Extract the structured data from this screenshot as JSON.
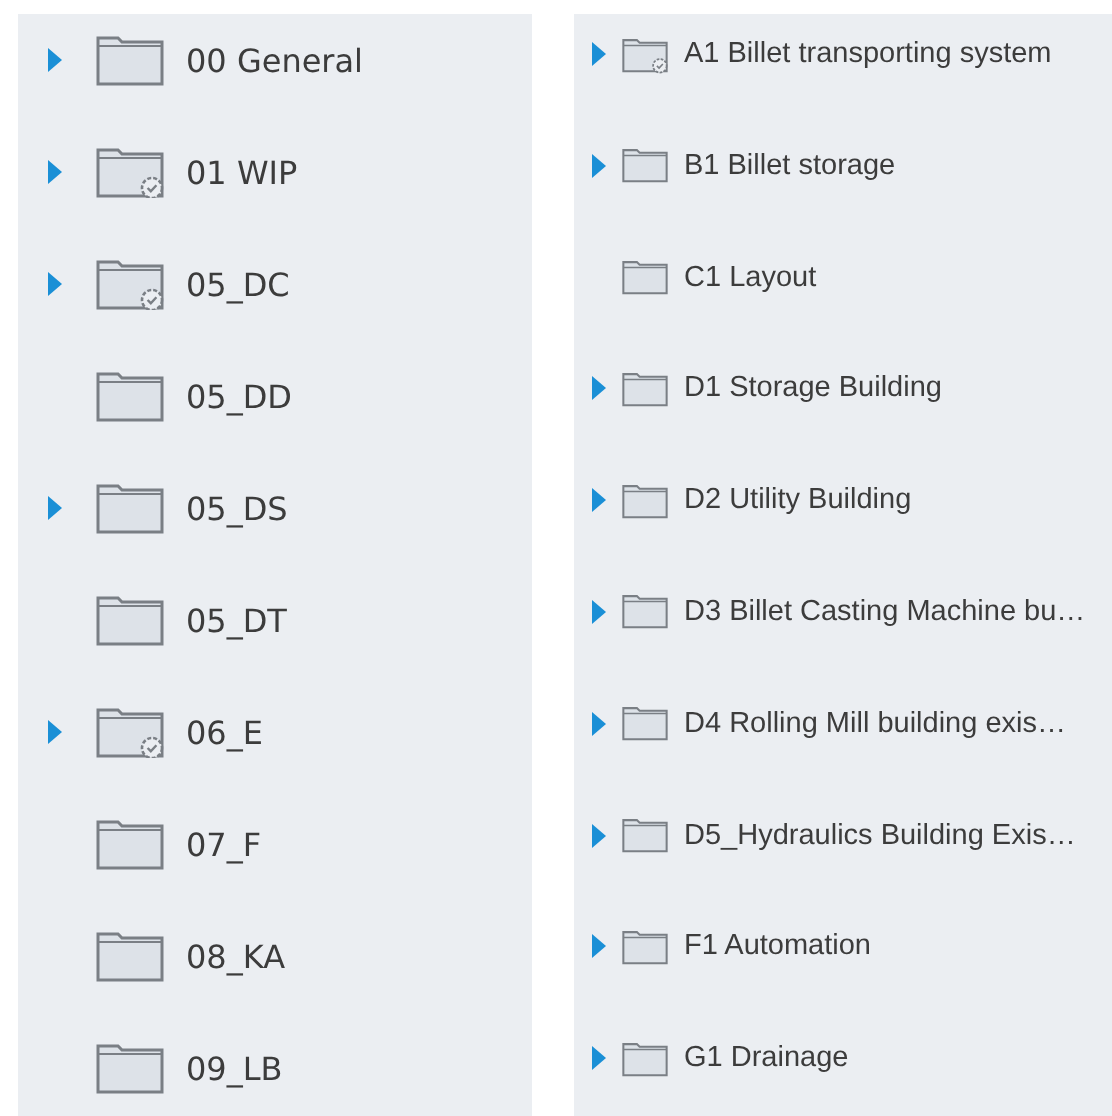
{
  "left_panel": {
    "items": [
      {
        "name": "00 General",
        "expandable": true,
        "shared": false
      },
      {
        "name": "01 WIP",
        "expandable": true,
        "shared": true
      },
      {
        "name": "05_DC",
        "expandable": true,
        "shared": true
      },
      {
        "name": "05_DD",
        "expandable": false,
        "shared": false
      },
      {
        "name": "05_DS",
        "expandable": true,
        "shared": false
      },
      {
        "name": "05_DT",
        "expandable": false,
        "shared": false
      },
      {
        "name": "06_E",
        "expandable": true,
        "shared": true
      },
      {
        "name": "07_F",
        "expandable": false,
        "shared": false
      },
      {
        "name": "08_KA",
        "expandable": false,
        "shared": false
      },
      {
        "name": "09_LB",
        "expandable": false,
        "shared": false
      }
    ]
  },
  "right_panel": {
    "items": [
      {
        "name": "A1 Billet transporting system",
        "expandable": true,
        "shared": true
      },
      {
        "name": "B1 Billet storage",
        "expandable": true,
        "shared": false
      },
      {
        "name": "C1 Layout",
        "expandable": false,
        "shared": false
      },
      {
        "name": "D1 Storage Building",
        "expandable": true,
        "shared": false
      },
      {
        "name": "D2 Utility Building",
        "expandable": true,
        "shared": false
      },
      {
        "name": "D3 Billet Casting Machine bu…",
        "expandable": true,
        "shared": false
      },
      {
        "name": "D4 Rolling Mill building exis…",
        "expandable": true,
        "shared": false
      },
      {
        "name": "D5_Hydraulics Building Exis…",
        "expandable": true,
        "shared": false
      },
      {
        "name": "F1 Automation",
        "expandable": true,
        "shared": false
      },
      {
        "name": "G1 Drainage",
        "expandable": true,
        "shared": false
      }
    ]
  }
}
